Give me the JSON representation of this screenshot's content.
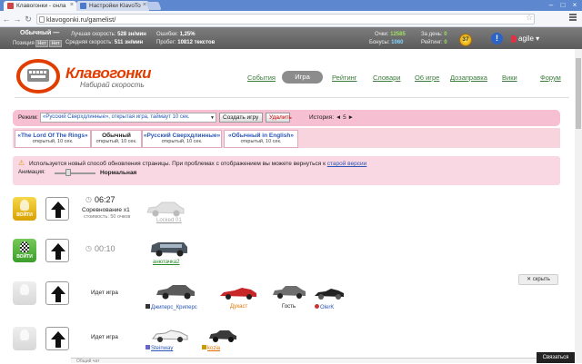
{
  "browser": {
    "tabs": [
      {
        "title": "Клавогонки - онла",
        "active": true
      },
      {
        "title": "Настройки KlavoTo",
        "active": false
      }
    ],
    "url": "klavogonki.ru/gamelist/"
  },
  "userbar": {
    "rank": "Обычный —",
    "position_label": "Позиция",
    "pos_badge1": "Нет",
    "pos_badge2": "Нет",
    "best_speed_label": "Лучшая скорость:",
    "best_speed": "528 зн/мин",
    "avg_speed_label": "Средняя скорость:",
    "avg_speed": "511 зн/мин",
    "errors_label": "Ошибки:",
    "errors": "1,25%",
    "mileage_label": "Пробег:",
    "mileage": "10812 текстов",
    "points_label": "Очки:",
    "points": "12585",
    "bonus_label": "Бонусы:",
    "bonus": "1060",
    "day_label": "За день:",
    "day": "0",
    "rating_label": "Рейтинг:",
    "rating": "0",
    "level": "37",
    "alert": "!",
    "username": "agile"
  },
  "site": {
    "brand": "Клавогонки",
    "slogan": "Набирай скорость",
    "nav": [
      "События",
      "Игра",
      "Рейтинг",
      "Словари",
      "О6 игре",
      "Дозаправка",
      "Вики",
      "Форум"
    ]
  },
  "mode": {
    "label": "Режим:",
    "selected": "«Русский Сверхдлинные», открытая игра, таймаут 10 сек.",
    "create": "Создать игру",
    "delete": "Удалить",
    "history_label": "История:",
    "history_value": "◄ 5 ►"
  },
  "mode_tabs": [
    {
      "title": "«The Lord Of The Rings»",
      "sub": "открытый, 10 сек."
    },
    {
      "title": "Обычный",
      "sub": "открытый, 10 сек."
    },
    {
      "title": "«Русский Сверхдлинные»",
      "sub": "открытый, 10 сек."
    },
    {
      "title": "«Обычный in English»",
      "sub": "открытый, 10 сек."
    }
  ],
  "notice": {
    "text": "Используется новый способ обновления страницы. При проблемах с отображением вы можете вернуться к",
    "link": "старой версии",
    "anim_label": "Анимация:",
    "anim_value": "Нормальная"
  },
  "games": [
    {
      "join": "ВОЙТИ",
      "timer": "06:27",
      "title": "Соревнование x1",
      "sub": "стоимость: 50 очков",
      "players": [
        "Locked 01"
      ]
    },
    {
      "join": "ВОЙТИ",
      "timer": "00:10",
      "players": [
        "анютачка2"
      ]
    },
    {
      "join": "",
      "status": "Идет игра",
      "hide": "✕ скрыть",
      "players": [
        "Джиперс_Криперс",
        "Духаст",
        "Гость",
        "OlerK"
      ]
    },
    {
      "join": "",
      "status": "Идет игра",
      "players": [
        "Steinway",
        "kozia"
      ]
    }
  ],
  "footer": {
    "chat": "Общий чат",
    "contact": "Связаться"
  },
  "colors": {
    "brand": "#e23d00",
    "pink_panel": "#f7bfd2",
    "nav_link": "#3a7a3a",
    "active_nav": "#8c8c8c",
    "browser_tabbar": "#5d88cf"
  }
}
